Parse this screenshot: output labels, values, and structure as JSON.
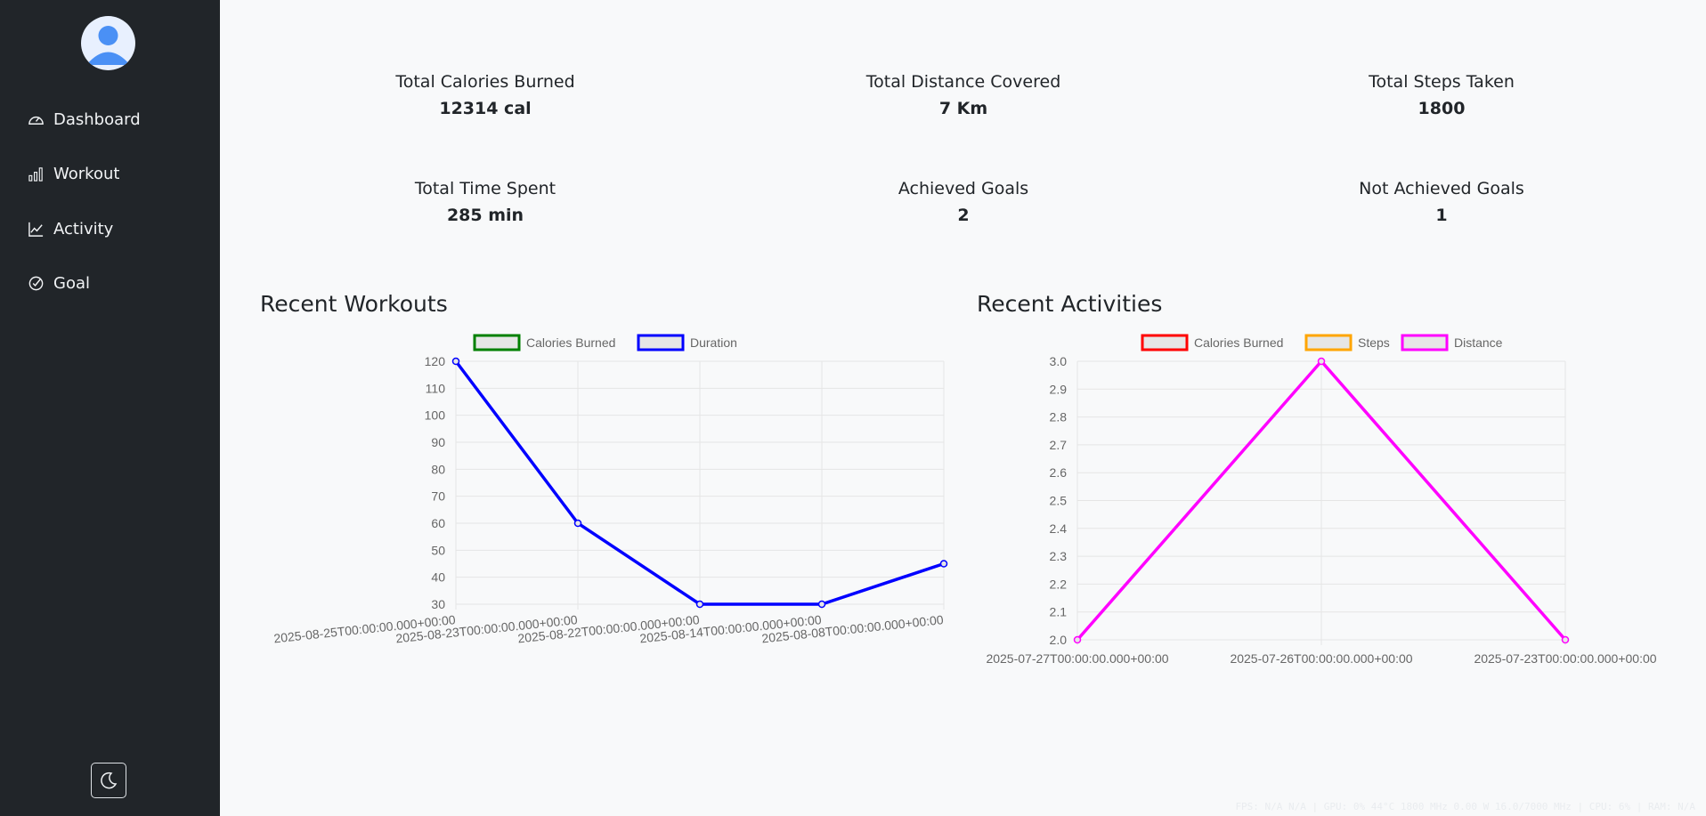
{
  "sidebar": {
    "items": [
      {
        "label": "Dashboard",
        "icon": "speedometer-icon"
      },
      {
        "label": "Workout",
        "icon": "bar-chart-icon"
      },
      {
        "label": "Activity",
        "icon": "line-chart-icon"
      },
      {
        "label": "Goal",
        "icon": "check-circle-icon"
      }
    ],
    "theme_toggle_icon": "moon-icon"
  },
  "stats": [
    {
      "label": "Total Calories Burned",
      "value": "12314 cal"
    },
    {
      "label": "Total Distance Covered",
      "value": "7 Km"
    },
    {
      "label": "Total Steps Taken",
      "value": "1800"
    },
    {
      "label": "Total Time Spent",
      "value": "285 min"
    },
    {
      "label": "Achieved Goals",
      "value": "2"
    },
    {
      "label": "Not Achieved Goals",
      "value": "1"
    }
  ],
  "sections": {
    "workouts_title": "Recent Workouts",
    "activities_title": "Recent Activities"
  },
  "footer": {
    "status_text": "FPS: N/A N/A | GPU: 0% 44°C 1800 MHz 0.00 W 16.0/7000 MHz | CPU: 6% | RAM: N/A"
  },
  "chart_data": [
    {
      "type": "line",
      "x": [
        "2025-08-25T00:00:00.000+00:00",
        "2025-08-23T00:00:00.000+00:00",
        "2025-08-22T00:00:00.000+00:00",
        "2025-08-14T00:00:00.000+00:00",
        "2025-08-08T00:00:00.000+00:00"
      ],
      "series": [
        {
          "name": "Calories Burned",
          "color": "#008000",
          "values": []
        },
        {
          "name": "Duration",
          "color": "#0000ff",
          "values": [
            120,
            60,
            30,
            30,
            45
          ]
        }
      ],
      "ylim": [
        30,
        120
      ],
      "yticks": [
        120,
        110,
        100,
        90,
        80,
        70,
        60,
        50,
        40,
        30
      ],
      "grid": true,
      "legend": "top"
    },
    {
      "type": "line",
      "x": [
        "2025-07-27T00:00:00.000+00:00",
        "2025-07-26T00:00:00.000+00:00",
        "2025-07-23T00:00:00.000+00:00"
      ],
      "series": [
        {
          "name": "Calories Burned",
          "color": "#ff0000",
          "values": []
        },
        {
          "name": "Steps",
          "color": "#ffa500",
          "values": []
        },
        {
          "name": "Distance",
          "color": "#ff00ff",
          "values": [
            2.0,
            3.0,
            2.0
          ]
        }
      ],
      "ylim": [
        2.0,
        3.0
      ],
      "yticks": [
        "3.0",
        "2.9",
        "2.8",
        "2.7",
        "2.6",
        "2.5",
        "2.4",
        "2.3",
        "2.2",
        "2.1",
        "2.0"
      ],
      "grid": true,
      "legend": "top"
    }
  ]
}
